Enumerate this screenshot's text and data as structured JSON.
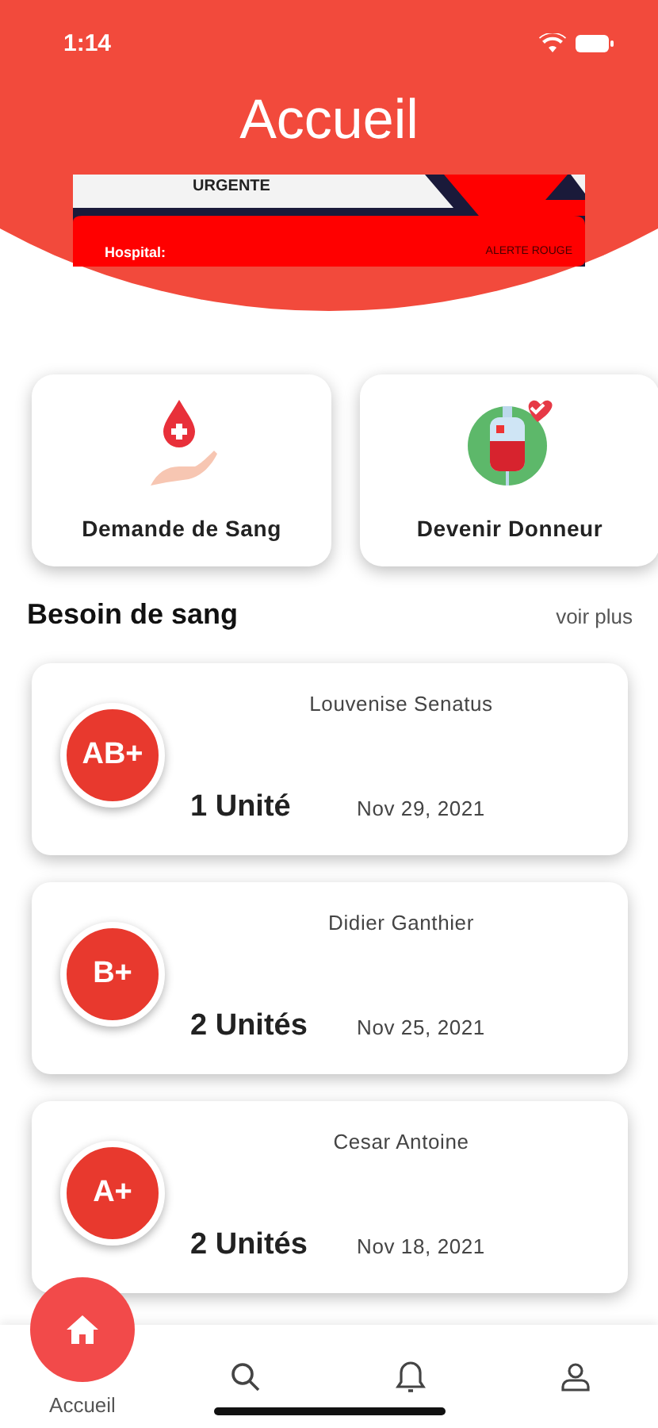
{
  "status_bar": {
    "time": "1:14"
  },
  "header": {
    "title": "Accueil"
  },
  "banner": {
    "top_text": "URGENTE",
    "left_text": "Hospital:",
    "right_text": "ALERTE ROUGE"
  },
  "actions": [
    {
      "label": "Demande de Sang",
      "kind": "request"
    },
    {
      "label": "Devenir Donneur",
      "kind": "donate"
    }
  ],
  "section": {
    "title": "Besoin de sang",
    "link": "voir plus"
  },
  "requests": [
    {
      "blood_type": "AB+",
      "name": "Louvenise Senatus",
      "units": "1 Unité",
      "date": "Nov 29, 2021"
    },
    {
      "blood_type": "B+",
      "name": "Didier Ganthier",
      "units": "2 Unités",
      "date": "Nov 25, 2021"
    },
    {
      "blood_type": "A+",
      "name": "Cesar Antoine",
      "units": "2 Unités",
      "date": "Nov 18, 2021"
    }
  ],
  "tab_bar": [
    {
      "kind": "home",
      "label": "Accueil",
      "selected": true
    },
    {
      "kind": "search",
      "selected": false
    },
    {
      "kind": "bell",
      "selected": false
    },
    {
      "kind": "profile",
      "selected": false
    }
  ]
}
